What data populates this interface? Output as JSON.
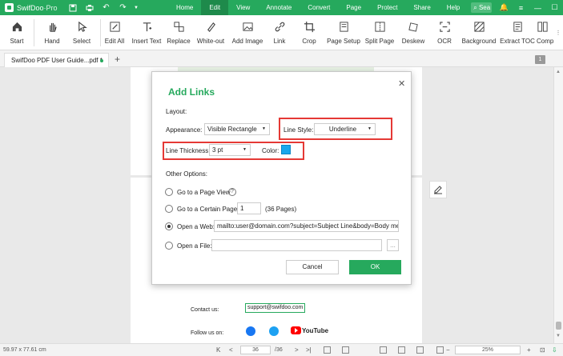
{
  "app": {
    "name": "SwifDoo",
    "edition": "Pro",
    "brand_color": "#26a95d"
  },
  "menu": [
    "Home",
    "Edit",
    "View",
    "Annotate",
    "Convert",
    "Page",
    "Protect",
    "Share",
    "Help"
  ],
  "search_label": "Sea",
  "ribbon": [
    {
      "label": "Start",
      "icon": "home-icon"
    },
    {
      "label": "Hand",
      "icon": "hand-icon"
    },
    {
      "label": "Select",
      "icon": "cursor-icon"
    },
    {
      "label": "Edit All",
      "icon": "edit-all-icon"
    },
    {
      "label": "Insert Text",
      "icon": "insert-text-icon"
    },
    {
      "label": "Replace",
      "icon": "replace-icon"
    },
    {
      "label": "White-out",
      "icon": "white-out-icon"
    },
    {
      "label": "Add Image",
      "icon": "image-icon"
    },
    {
      "label": "Link",
      "icon": "link-icon"
    },
    {
      "label": "Crop",
      "icon": "crop-icon"
    },
    {
      "label": "Page Setup",
      "icon": "page-setup-icon"
    },
    {
      "label": "Split Page",
      "icon": "split-page-icon"
    },
    {
      "label": "Deskew",
      "icon": "deskew-icon"
    },
    {
      "label": "OCR",
      "icon": "ocr-icon"
    },
    {
      "label": "Background",
      "icon": "background-icon"
    },
    {
      "label": "Extract TOC",
      "icon": "extract-toc-icon"
    },
    {
      "label": "Comp",
      "icon": "compare-icon"
    }
  ],
  "tab": {
    "title": "SwifDoo PDF User Guide...pdf *",
    "page_badge": "1"
  },
  "page": {
    "contact_label": "Contact us:",
    "contact_email": "support@swifdoo.com",
    "follow_label": "Follow us on:",
    "youtube_text": "YouTube"
  },
  "dialog": {
    "title": "Add Links",
    "layout_label": "Layout:",
    "appearance_label": "Appearance:",
    "appearance_value": "Visible Rectangle",
    "line_style_label": "Line Style:",
    "line_style_value": "Underline",
    "line_thickness_label": "Line Thickness:",
    "line_thickness_value": "3 pt",
    "color_label": "Color:",
    "color_value": "#1aa7ec",
    "other_options_label": "Other Options:",
    "opt_page_view": "Go to a Page View",
    "opt_certain_page": "Go to a Certain Page:",
    "certain_page_value": "1",
    "certain_page_total": "(36 Pages)",
    "opt_web": "Open a Web:",
    "web_value": "mailto:user@domain.com?subject=Subject Line&body=Body me:",
    "opt_file": "Open a File:",
    "browse_label": "...",
    "cancel_label": "Cancel",
    "ok_label": "OK",
    "selected_option": "web"
  },
  "status": {
    "coords": "59.97 x 77.61 cm",
    "current_page": "36",
    "total_pages": "/36",
    "zoom": "25%"
  }
}
